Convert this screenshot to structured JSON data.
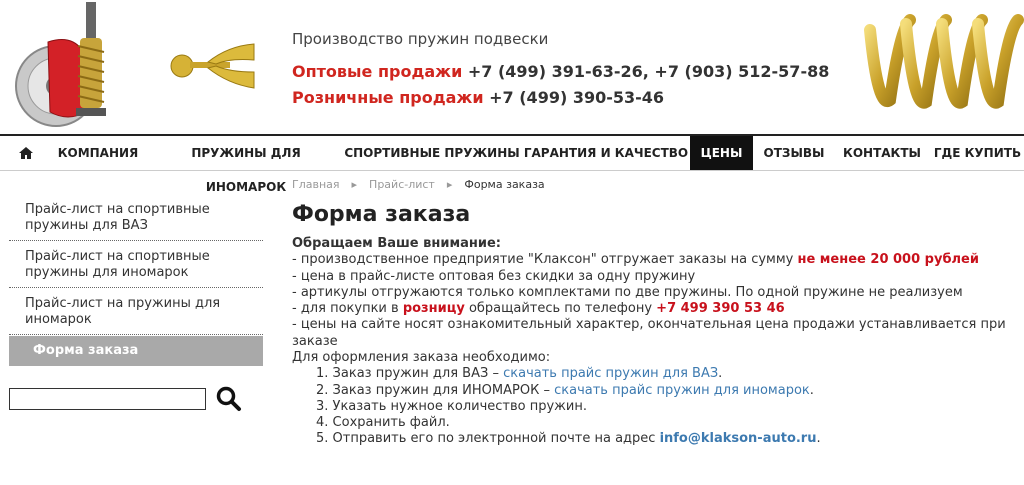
{
  "header": {
    "tagline": "Производство пружин подвески",
    "wholesale_label": "Оптовые продажи",
    "wholesale_phones": " +7 (499) 391-63-26, +7 (903) 512-57-88",
    "retail_label": "Розничные продажи",
    "retail_phones": " +7 (499) 390-53-46"
  },
  "nav": {
    "items": [
      {
        "label": "Компания"
      },
      {
        "label": "Пружины для иномарок"
      },
      {
        "label": "Спортивные пружины"
      },
      {
        "label": "Гарантия и качество"
      },
      {
        "label": "Цены"
      },
      {
        "label": "Отзывы"
      },
      {
        "label": "Контакты"
      },
      {
        "label": "Где купить"
      }
    ],
    "active": "Цены"
  },
  "sidebar": {
    "items": [
      {
        "label": "Прайс-лист на спортивные пружины для ВАЗ"
      },
      {
        "label": "Прайс-лист на спортивные пружины для иномарок"
      },
      {
        "label": "Прайс-лист на пружины для иномарок"
      },
      {
        "label": "Форма заказа"
      }
    ],
    "search_value": ""
  },
  "breadcrumb": {
    "home": "Главная",
    "pricelist": "Прайс-лист",
    "current": "Форма заказа",
    "separator": "▸"
  },
  "main": {
    "title": "Форма заказа",
    "attention": "Обращаем Ваше внимание:",
    "line1_pre": "- производственное предприятие \"Клаксон\" отгружает заказы на сумму ",
    "line1_red": "не менее 20 000 рублей",
    "line2": "- цена в прайс-листе оптовая без скидки за одну пружину",
    "line3": "- артикулы отгружаются только комплектами по две пружины. По одной пружине не реализуем",
    "line4_pre": "- для покупки в ",
    "line4_red": "розницу",
    "line4_mid": " обращайтесь по телефону ",
    "line4_phone": "+7 499 390 53 46",
    "line5": "- цены на сайте носят ознакомительный характер, окончательная цена продажи устанавливается при заказе",
    "order_intro": "Для оформления заказа необходимо:",
    "step1_pre": "1. Заказ пружин для ВАЗ – ",
    "step1_link": "скачать прайс пружин для ВАЗ",
    "step1_post": ".",
    "step2_pre": "2. Заказ пружин для ИНОМАРОК – ",
    "step2_link": "скачать прайс пружин для иномарок",
    "step2_post": ".",
    "step3": "3. Указать нужное количество пружин.",
    "step4": "4. Сохранить файл.",
    "step5_pre": "5. Отправить его по электронной почте на адрес ",
    "step5_email": "info@klakson-auto.ru",
    "step5_post": "."
  },
  "icons": {
    "home": "home-icon",
    "search": "search-icon"
  },
  "colors": {
    "accent_red": "#c8111c",
    "link_blue": "#3d7ab0",
    "nav_active_bg": "#111111",
    "sidebar_active_bg": "#a9a9a9"
  }
}
